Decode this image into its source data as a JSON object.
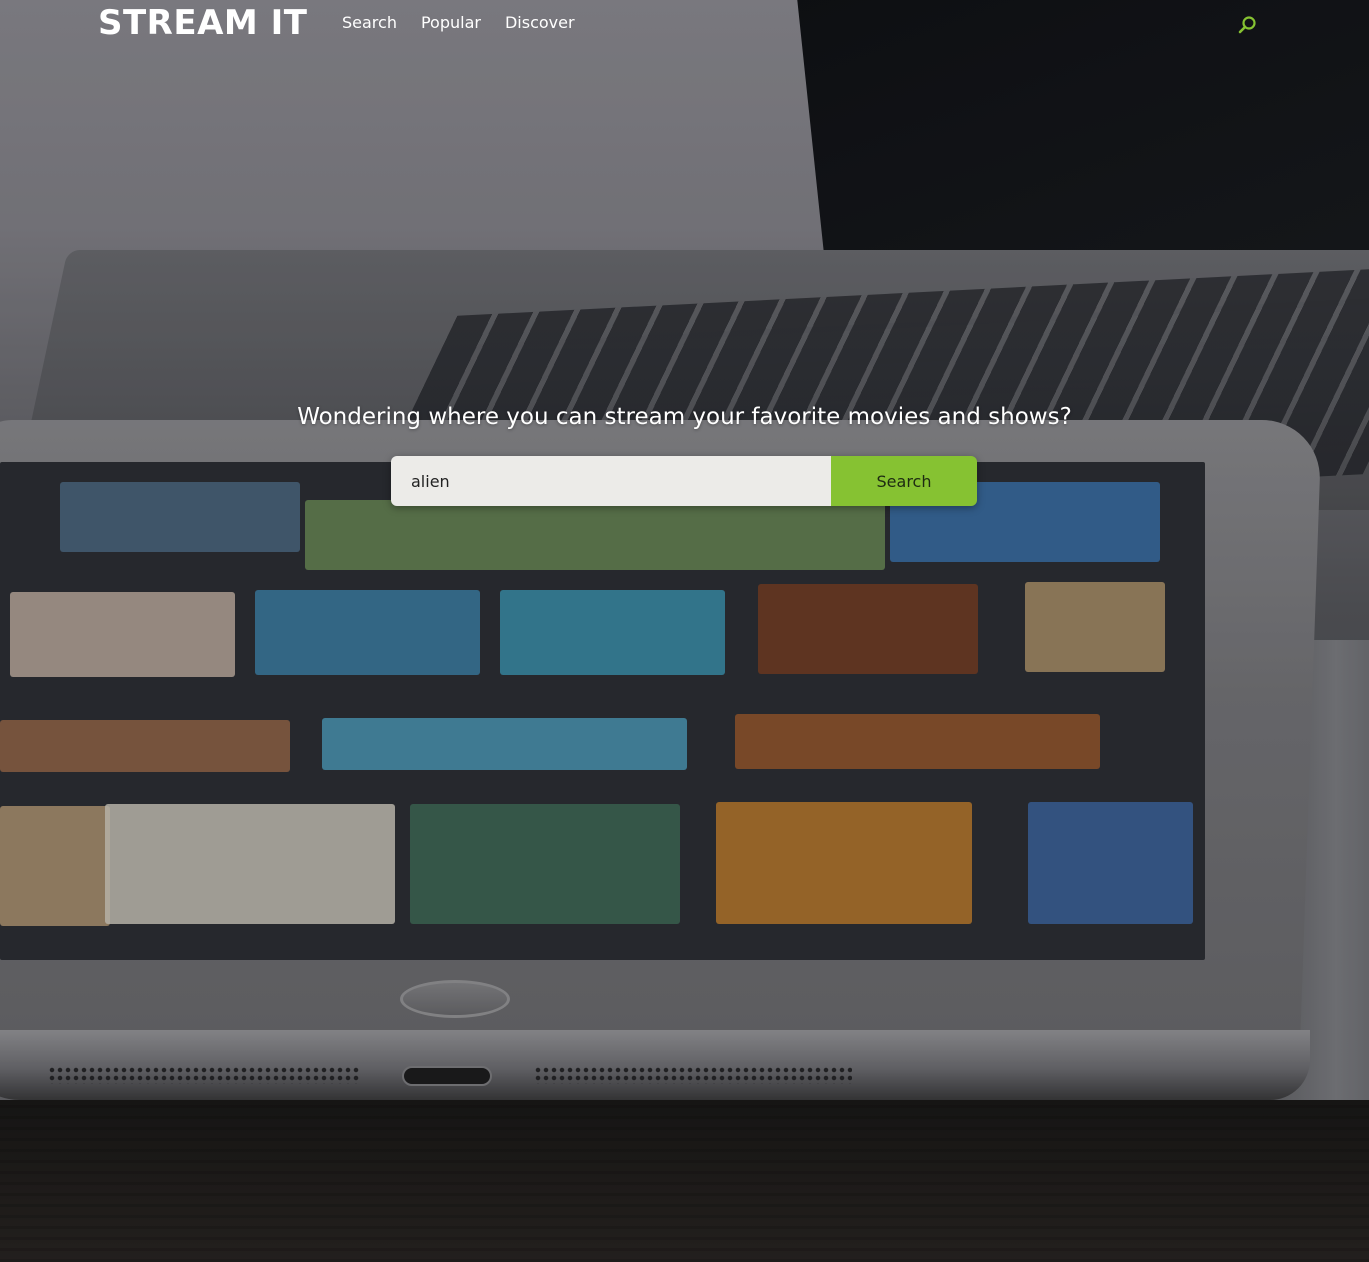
{
  "brand": {
    "name": "STREAM IT"
  },
  "nav": {
    "items": [
      {
        "label": "Search"
      },
      {
        "label": "Popular"
      },
      {
        "label": "Discover"
      }
    ]
  },
  "header": {
    "search_icon": "search-icon"
  },
  "hero": {
    "title": "Wondering where you can stream your favorite movies and shows?",
    "search": {
      "value": "alien",
      "button_label": "Search"
    }
  },
  "colors": {
    "accent": "#86c232",
    "text": "#ffffff",
    "input_bg": "#ecebe8"
  }
}
